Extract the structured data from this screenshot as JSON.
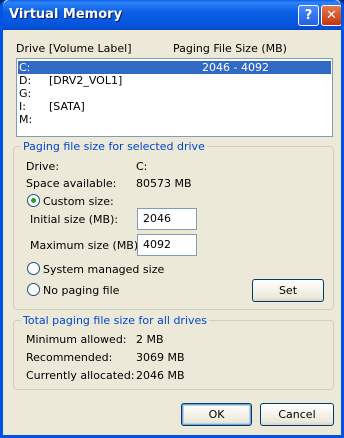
{
  "window": {
    "title": "Virtual Memory",
    "help_label": "?",
    "close_label": "✕"
  },
  "drive_list": {
    "header_drive": "Drive  [Volume Label]",
    "header_size": "Paging File Size (MB)",
    "rows": [
      {
        "drive": "C:",
        "label": "",
        "size": "2046 - 4092",
        "selected": true
      },
      {
        "drive": "D:",
        "label": "[DRV2_VOL1]",
        "size": ""
      },
      {
        "drive": "G:",
        "label": "",
        "size": ""
      },
      {
        "drive": "I:",
        "label": "[SATA]",
        "size": ""
      },
      {
        "drive": "M:",
        "label": "",
        "size": ""
      }
    ]
  },
  "selected_group": {
    "title": "Paging file size for selected drive",
    "drive_label": "Drive:",
    "drive_value": "C:",
    "space_label": "Space available:",
    "space_value": "80573 MB",
    "custom_size_label": "Custom size:",
    "initial_label": "Initial size (MB):",
    "initial_value": "2046",
    "maximum_label": "Maximum size (MB):",
    "maximum_value": "4092",
    "system_managed_label": "System managed size",
    "no_paging_label": "No paging file",
    "set_button": "Set",
    "selected_option": "custom"
  },
  "total_group": {
    "title": "Total paging file size for all drives",
    "minimum_label": "Minimum allowed:",
    "minimum_value": "2 MB",
    "recommended_label": "Recommended:",
    "recommended_value": "3069 MB",
    "allocated_label": "Currently allocated:",
    "allocated_value": "2046 MB"
  },
  "buttons": {
    "ok": "OK",
    "cancel": "Cancel"
  },
  "colors": {
    "accent": "#0046d5",
    "selection": "#316ac5",
    "titlebar": "#0a5fe5"
  }
}
